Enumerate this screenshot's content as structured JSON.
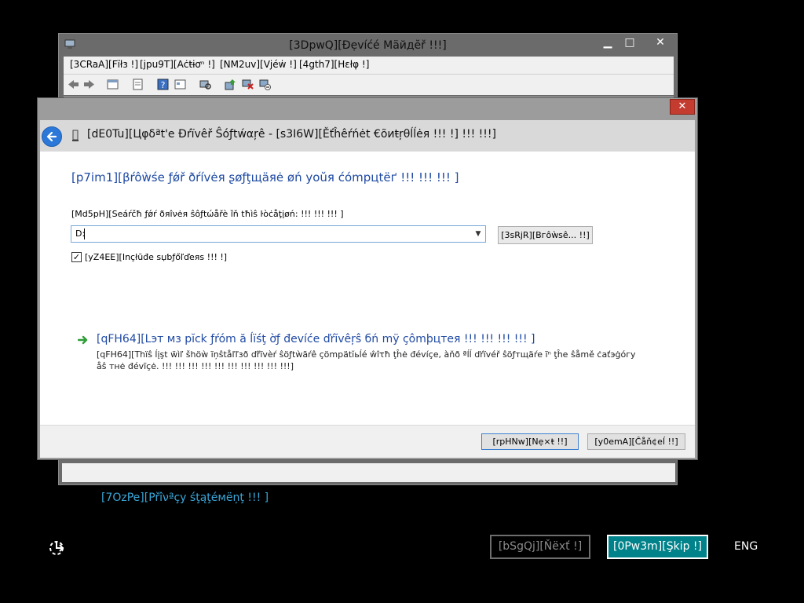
{
  "device_manager": {
    "title": "[3DpwQ][Ɖẹvíćé Мäйдӗř !!!]",
    "menu": [
      "[3CRaA][Fïłз !]",
      "[jpu9T][Аċŧɨơⁿ !]",
      "[NM2uv][Vjéẇ !]",
      "[4gth7][Нɛłφ !]"
    ],
    "caption_buttons": {
      "minimize": "▁",
      "maximize": "□",
      "close": "✕"
    },
    "toolbar_icons": [
      "back-icon",
      "forward-icon",
      "properties-icon",
      "show-hide-tree-icon",
      "help-icon",
      "view-icon",
      "scan-hardware-icon",
      "update-driver-icon",
      "disable-device-icon",
      "uninstall-device-icon"
    ]
  },
  "wizard": {
    "title": "[dE0Tu][Цφδªt'e Ðŕïvêř Ŝóƒtẃαŗê - [s3I6W][Ěťĥêŕńėt €õиŧŗθĺĺėя !!! !] !!! !!!]",
    "close_glyph": "✕",
    "heading": "[p7im1][βŕôẁśe ƒǿř ðŕívėя ʂøƒţщäяė øń yoŭя ćómpцtëґ !!! !!! !!! ]",
    "search_label": "[Md5pH][Seáŕčħ ƒǿŕ ðяîνėя ŝôƒtώåřè ȉň tħìŝ ŀòċåţįøń: !!! !!! !!! ]",
    "path_value": "D:",
    "browse_label": "[3sRjR][Bгôẁѕê... !!]",
    "include_label": "[yZ4EE][Іnçłūđe ѕџƅƒőľďeяs !!! !]",
    "include_checked": true,
    "pick_link": "[qFH64][Lэт мз pĭck ƒŕóm ă ĺïśţ ờƒ đevíće ďŕĭvêŗŝ бń mӱ çômþцтея !!! !!! !!! !!! ]",
    "pick_description": "[qFH64][Thïŝ ĺįşt ẅìľ šhöẁ ĩņŝtåľľзð ďřĩvèŕ ŝöƒtẁãŕê çömpätĭьĺé ŵîτħ ţĥė đévíçe, àňð ªĺĺ ďŕïvéř ŝöƒтщäŕe ĩⁿ ţĥe ŝåmě ċaťэġóгу åŝ тнė đévĩçė. !!! !!! !!! !!! !!! !!! !!! !!! !!! !!!]",
    "next_label": "[rpHNw][Nẹ×ŧ !!]",
    "cancel_label": "[y0emA][Ĉåň¢еĺ !!]"
  },
  "oobe": {
    "privacy_link": "[7OzPe][Přîνªçу śţąţéмëņţ !!! ]",
    "next_label": "[bSgQj][Ňёxť !]",
    "skip_label": "[0Pw3m][Şkip !]",
    "language": "ENG"
  },
  "colors": {
    "accent_teal": "#00828a",
    "link_blue": "#1f4aa3",
    "privacy_link": "#3aa7d9",
    "close_red": "#c43b2f"
  }
}
